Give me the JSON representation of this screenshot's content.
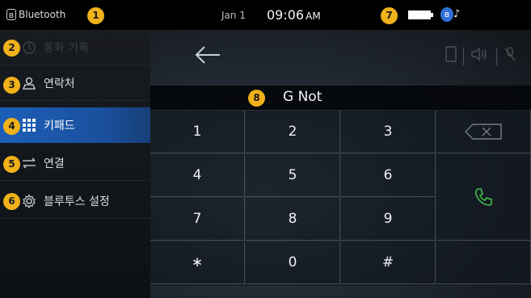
{
  "status_bar": {
    "bluetooth_label": "Bluetooth",
    "date": "Jan 1",
    "time": "09:06",
    "ampm": "AM",
    "phone_battery_icon": "battery-icon",
    "bt_audio_icon": "bluetooth-audio-icon"
  },
  "badges": [
    "1",
    "2",
    "3",
    "4",
    "5",
    "6",
    "7",
    "8"
  ],
  "sidebar": {
    "items": [
      {
        "label": "통화 기록",
        "icon": "call-history-icon",
        "state": "dim"
      },
      {
        "label": "연락처",
        "icon": "contacts-icon",
        "state": "normal"
      },
      {
        "label": "키패드",
        "icon": "keypad-icon",
        "state": "active"
      },
      {
        "label": "연결",
        "icon": "connection-icon",
        "state": "normal"
      },
      {
        "label": "블루투스 설정",
        "icon": "settings-icon",
        "state": "normal"
      }
    ]
  },
  "main": {
    "back_icon": "back-arrow-icon",
    "number_display": "G Not",
    "keys": [
      "1",
      "2",
      "3",
      "4",
      "5",
      "6",
      "7",
      "8",
      "9",
      "∗",
      "0",
      "#"
    ],
    "delete_icon": "backspace-icon",
    "call_icon": "call-icon"
  },
  "colors": {
    "accent": "#1d5fb8",
    "badge": "#f0b11a",
    "call_green": "#3fbf4a"
  }
}
